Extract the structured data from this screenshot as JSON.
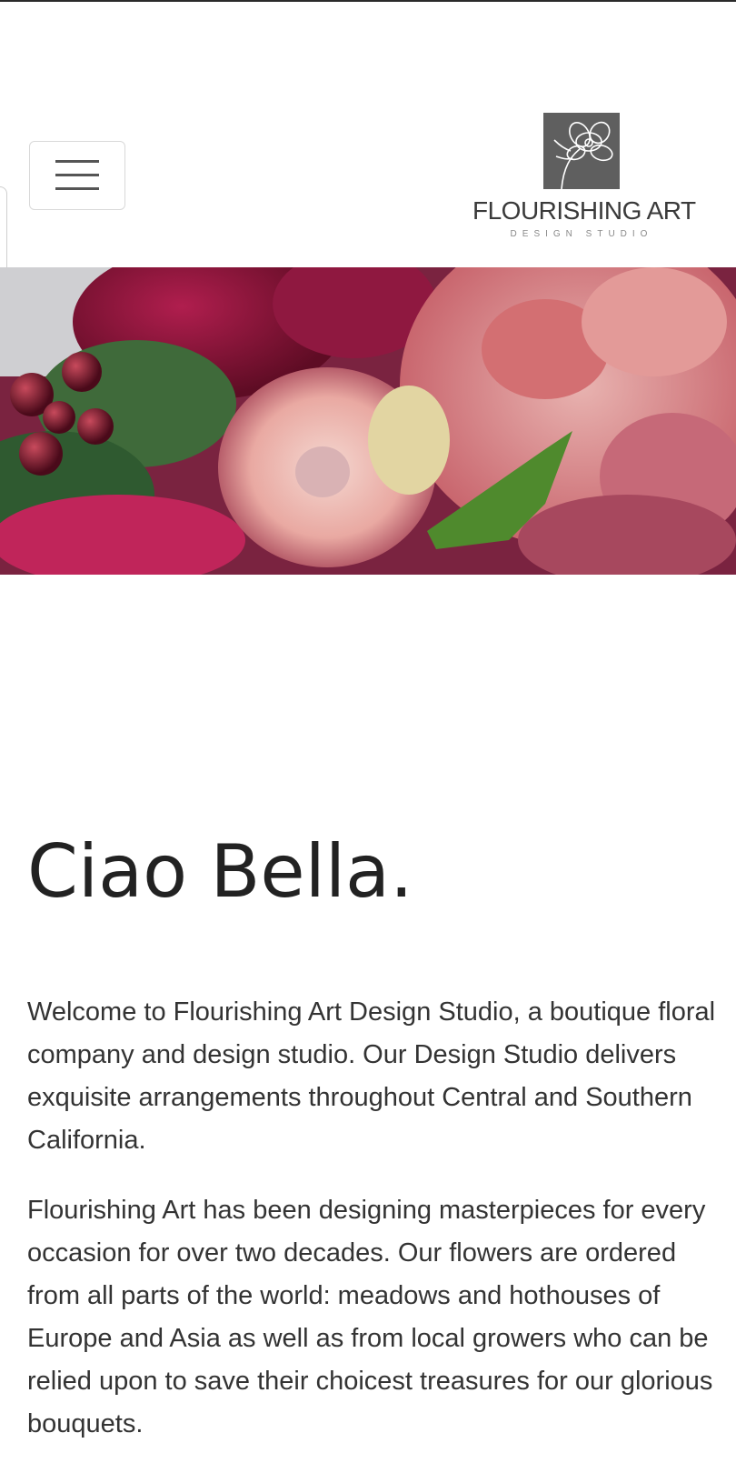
{
  "header": {
    "menu_icon": "hamburger-menu-icon",
    "logo": {
      "name": "FLOURISHING ART",
      "tagline": "DESIGN STUDIO",
      "icon": "flower-logo-icon"
    }
  },
  "hero": {
    "image": "floral-arrangement-photo",
    "slides_count": 4,
    "active_slide": 1
  },
  "main": {
    "heading": "Ciao Bella.",
    "paragraphs": [
      "Welcome to Flourishing Art Design Studio, a boutique floral company and design studio. Our Design Studio delivers exquisite arrangements throughout Central and Southern California.",
      "Flourishing Art has been designing masterpieces for every occasion for over two decades. Our flowers are ordered from all parts of the world: meadows and hothouses of Europe and Asia as well as from local growers who can be relied upon to save their choicest treasures for our glorious bouquets."
    ]
  },
  "colors": {
    "accent": "#1fbfbf",
    "text": "#333333",
    "logo_gray": "#5f5f5f"
  }
}
